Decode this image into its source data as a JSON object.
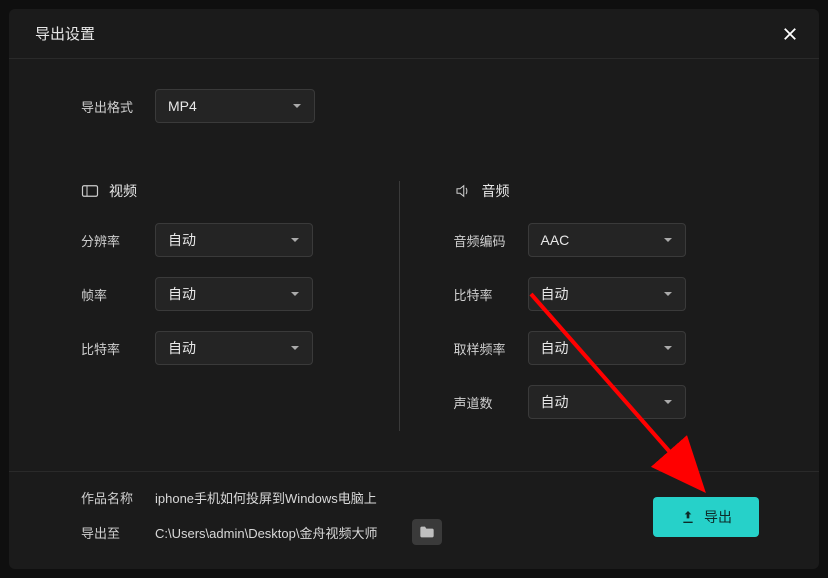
{
  "dialog": {
    "title": "导出设置"
  },
  "format": {
    "label": "导出格式",
    "value": "MP4"
  },
  "video": {
    "heading": "视频",
    "resolution": {
      "label": "分辨率",
      "value": "自动"
    },
    "fps": {
      "label": "帧率",
      "value": "自动"
    },
    "bitrate": {
      "label": "比特率",
      "value": "自动"
    }
  },
  "audio": {
    "heading": "音频",
    "codec": {
      "label": "音频编码",
      "value": "AAC"
    },
    "bitrate": {
      "label": "比特率",
      "value": "自动"
    },
    "sampleRate": {
      "label": "取样频率",
      "value": "自动"
    },
    "channels": {
      "label": "声道数",
      "value": "自动"
    }
  },
  "meta": {
    "name": {
      "label": "作品名称",
      "value": "iphone手机如何投屏到Windows电脑上"
    },
    "path": {
      "label": "导出至",
      "value": "C:\\Users\\admin\\Desktop\\金舟视频大师"
    }
  },
  "export": {
    "label": "导出"
  },
  "colors": {
    "accent": "#26d1c9",
    "arrow": "#FF0000"
  }
}
